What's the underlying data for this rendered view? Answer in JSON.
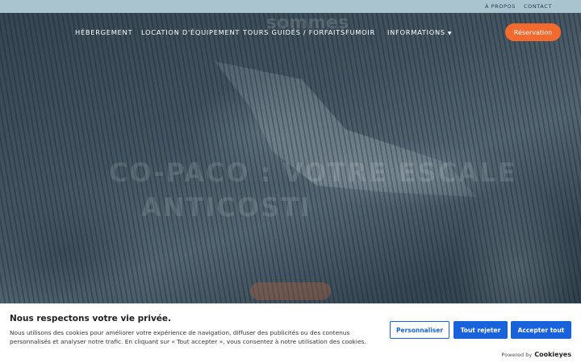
{
  "topbar": {
    "links": [
      "À PROPOS",
      "CONTACT"
    ]
  },
  "nav": {
    "items": [
      "HÉBERGEMENT",
      "LOCATION D'ÉQUIPEMENT",
      "TOURS GUIDÉS / FORFAITS",
      "FUMOIR",
      "INFORMATIONS"
    ],
    "reserve_label": "Réservation"
  },
  "hero": {
    "ghost_top": "sommes",
    "ghost_title_1": "CO-PACO : VOTRE ESCALE",
    "ghost_title_2": "ANTICOSTI"
  },
  "cookie": {
    "title": "Nous respectons votre vie privée.",
    "text": "Nous utilisons des cookies pour améliorer votre expérience de navigation, diffuser des publicités ou des contenus personnalisés et analyser notre trafic. En cliquant sur « Tout accepter », vous consentez à notre utilisation des cookies.",
    "customize_label": "Personnaliser",
    "reject_label": "Tout rejeter",
    "accept_label": "Accepter tout",
    "powered_by": "Powered by",
    "brand": "Cookieyes"
  },
  "colors": {
    "accent": "#f26a2d",
    "cookie_button": "#1863dc",
    "topbar": "#a9c3cf"
  }
}
